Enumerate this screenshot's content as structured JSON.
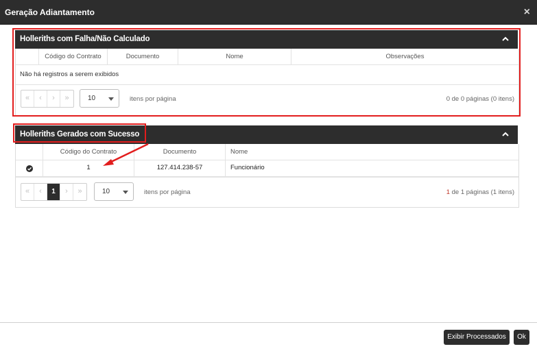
{
  "dialog": {
    "title": "Geração Adiantamento",
    "close_label": "×"
  },
  "failed_panel": {
    "title": "Holleriths com Falha/Não Calculado",
    "columns": [
      "Código do Contrato",
      "Documento",
      "Nome",
      "Observações"
    ],
    "empty_message": "Não há registros a serem exibidos",
    "pager": {
      "first": "«",
      "prev": "‹",
      "next": "›",
      "last": "»"
    },
    "page_size": "10",
    "items_label": "itens por página",
    "summary": "0 de 0 páginas (0 itens)"
  },
  "success_panel": {
    "title": "Holleriths Gerados com Sucesso",
    "columns": [
      "Código do Contrato",
      "Documento",
      "Nome"
    ],
    "rows": [
      {
        "codigo": "1",
        "documento": "127.414.238-57",
        "nome": "Funcionário"
      }
    ],
    "pager": {
      "first": "«",
      "prev": "‹",
      "current": "1",
      "next": "›",
      "last": "»"
    },
    "page_size": "10",
    "items_label": "itens por página",
    "summary": "1 de 1 páginas (1 itens)"
  },
  "footer": {
    "show_processed_label": "Exibir Processados",
    "ok_label": "Ok"
  },
  "colors": {
    "header_dark": "#2d2d2d",
    "annotation_red": "#e21d1d",
    "success_summary": "#c0392b"
  }
}
